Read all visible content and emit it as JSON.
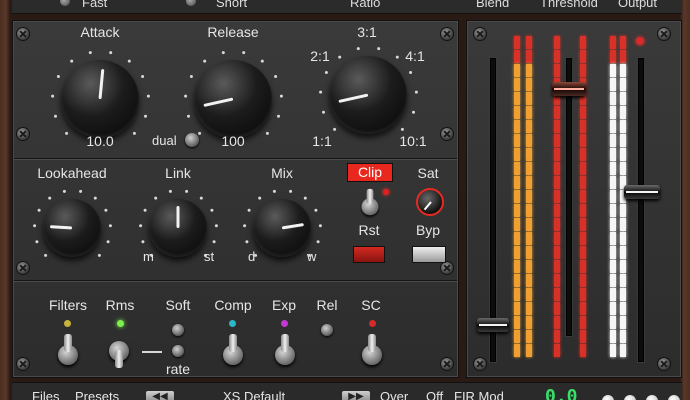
{
  "top_strip": {
    "fast_label": "Fast",
    "short_label": "Short",
    "ratio_label": "Ratio",
    "blend_label": "Blend",
    "threshold_label": "Threshold",
    "output_label": "Output"
  },
  "row1": {
    "attack": {
      "label": "Attack",
      "value": "10.0",
      "level": 0.52
    },
    "release": {
      "label": "Release",
      "value": "100",
      "dual_label": "dual",
      "level": 0.12
    },
    "ratio": {
      "label_top": "3:1",
      "label_left": "2:1",
      "label_right": "4:1",
      "label_bl": "1:1",
      "label_br": "10:1",
      "level": 0.12
    }
  },
  "row2": {
    "lookahead": {
      "label": "Lookahead",
      "level": 0.18
    },
    "link": {
      "label": "Link",
      "min_label": "m",
      "max_label": "st",
      "level": 0.5
    },
    "mix": {
      "label": "Mix",
      "min_label": "d",
      "max_label": "w",
      "level": 0.8
    },
    "clip": {
      "label": "Clip",
      "rst_label": "Rst",
      "clip_color": "#e8281e"
    },
    "sat": {
      "label": "Sat",
      "byp_label": "Byp"
    }
  },
  "row3": {
    "filters_label": "Filters",
    "rms_label": "Rms",
    "soft_label": "Soft",
    "rate_label": "rate",
    "comp_label": "Comp",
    "exp_label": "Exp",
    "rel_label": "Rel",
    "sc_label": "SC",
    "led_colors": {
      "filters": "#c8b43a",
      "rms": "#7cf04a",
      "comp": "#2ab8c8",
      "exp": "#c23ad0",
      "sc": "#d42a2a"
    }
  },
  "meters": {
    "blend_level": 0.08,
    "threshold_level": 0.9,
    "output_level": 0.54,
    "colors": {
      "orange": "#f0a030",
      "red": "#d83228",
      "white": "#f6f6f6"
    }
  },
  "bottom_bar": {
    "files_label": "Files",
    "presets_label": "Presets",
    "prev_icon": "◀◀",
    "preset_name": "XS Default",
    "next_icon": "▶▶",
    "over_label": "Over",
    "off_label": "Off",
    "fir_label": "FIR Mod",
    "readout": "0.0"
  }
}
